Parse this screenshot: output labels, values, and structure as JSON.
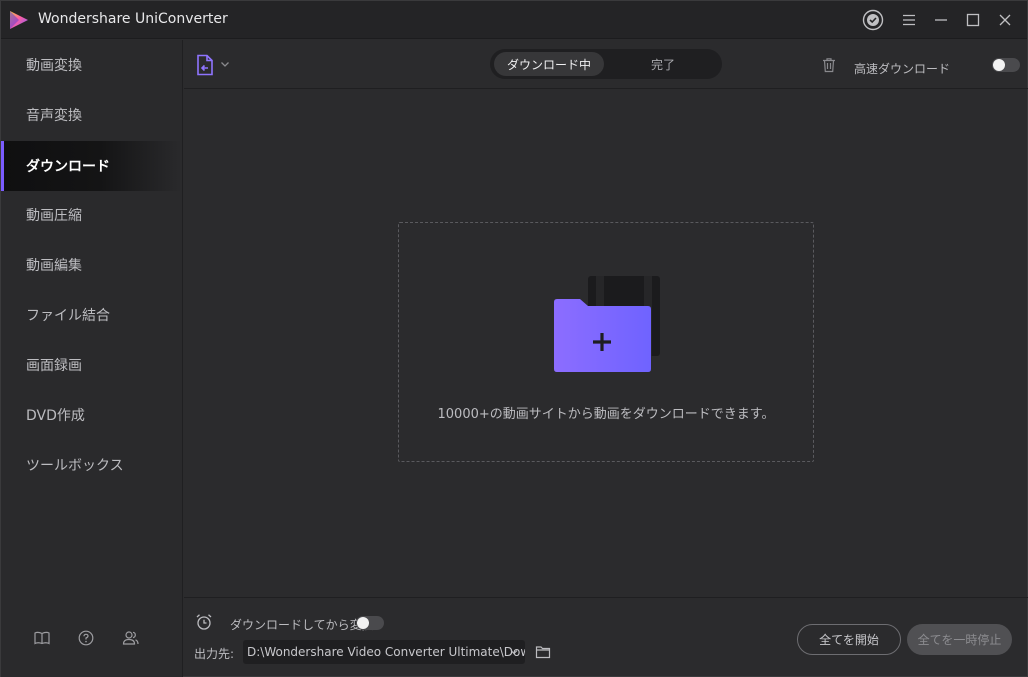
{
  "app": {
    "title": "Wondershare UniConverter"
  },
  "sidebar": {
    "items": [
      {
        "label": "動画変換"
      },
      {
        "label": "音声変換"
      },
      {
        "label": "ダウンロード",
        "active": true
      },
      {
        "label": "動画圧縮"
      },
      {
        "label": "動画編集"
      },
      {
        "label": "ファイル結合"
      },
      {
        "label": "画面録画"
      },
      {
        "label": "DVD作成"
      },
      {
        "label": "ツールボックス"
      }
    ],
    "footer_icons": [
      "book-icon",
      "help-icon",
      "user-group-icon"
    ]
  },
  "toolbar": {
    "tabs": [
      {
        "label": "ダウンロード中",
        "selected": true
      },
      {
        "label": "完了",
        "selected": false
      }
    ],
    "fast_download_label": "高速ダウンロード",
    "fast_download_on": false
  },
  "dropzone": {
    "text": "10000+の動画サイトから動画をダウンロードできます。"
  },
  "bottom": {
    "convert_after_label": "ダウンロードしてから変換",
    "convert_after_on": false,
    "output_label": "出力先:",
    "output_path": "D:\\Wondershare Video Converter Ultimate\\Dow",
    "start_all_label": "全てを開始",
    "pause_all_label": "全てを一時停止"
  },
  "colors": {
    "accent": "#7b5cff",
    "background": "#2b2b2d",
    "sidebar": "#2a2a2c"
  }
}
